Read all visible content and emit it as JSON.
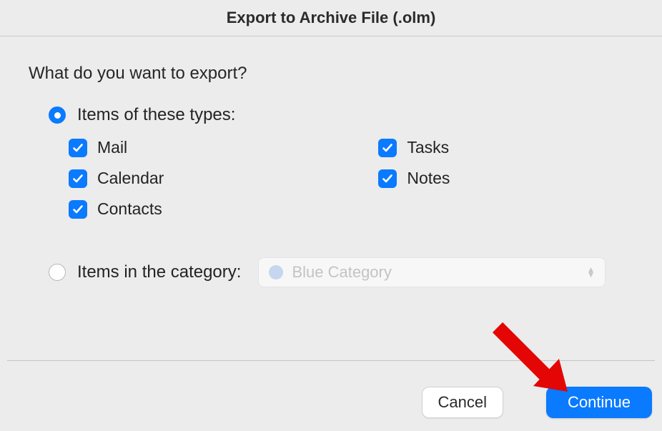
{
  "title": "Export to Archive File (.olm)",
  "prompt": "What do you want to export?",
  "options": {
    "types": {
      "label": "Items of these types:",
      "selected": true,
      "items": {
        "mail": {
          "label": "Mail",
          "checked": true
        },
        "calendar": {
          "label": "Calendar",
          "checked": true
        },
        "contacts": {
          "label": "Contacts",
          "checked": true
        },
        "tasks": {
          "label": "Tasks",
          "checked": true
        },
        "notes": {
          "label": "Notes",
          "checked": true
        }
      }
    },
    "category": {
      "label": "Items in the category:",
      "selected": false,
      "select": {
        "value": "Blue Category",
        "swatch_color": "#b6cdef",
        "disabled": true
      }
    }
  },
  "buttons": {
    "cancel": "Cancel",
    "continue": "Continue"
  },
  "annotation": {
    "arrow_color": "#e40505"
  }
}
